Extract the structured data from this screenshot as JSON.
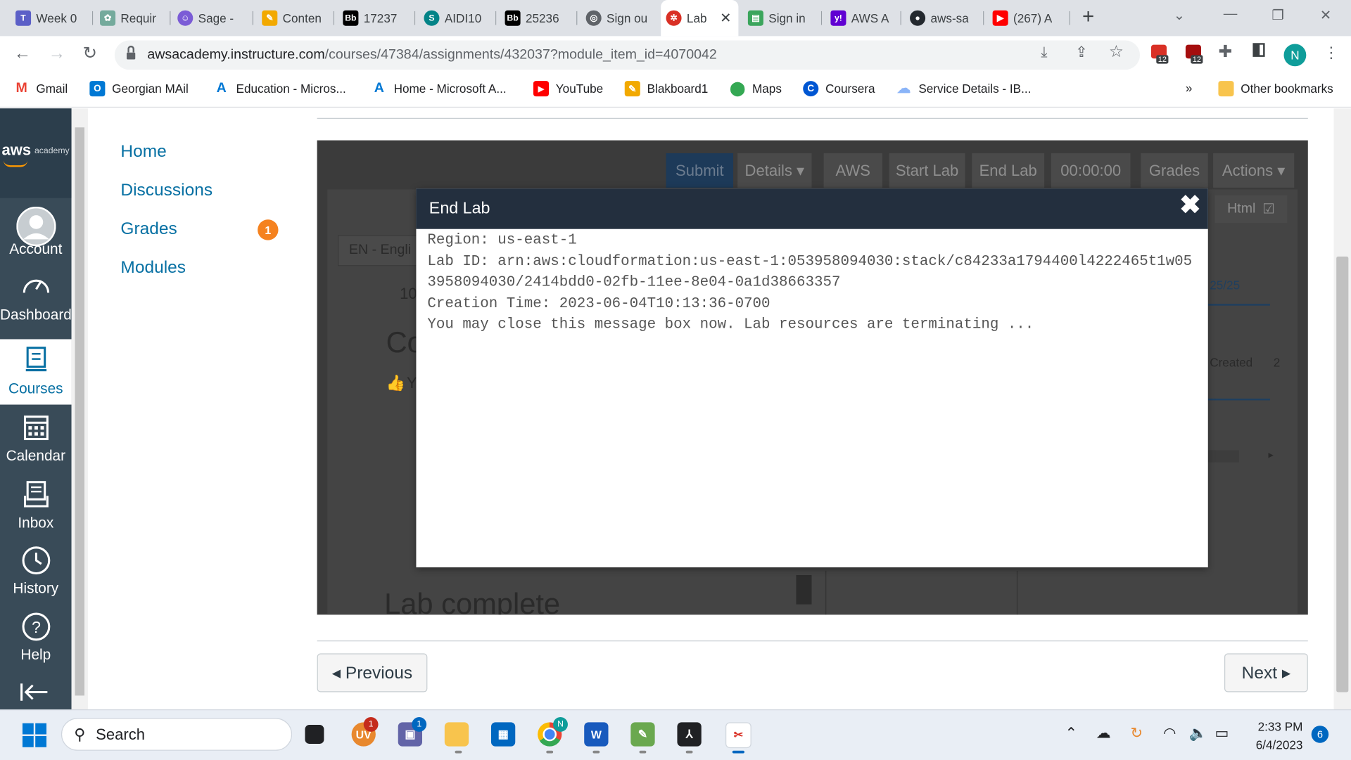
{
  "browser": {
    "tabs": [
      {
        "label": "Week 0",
        "icon": "teams-icon",
        "color": "#5b5fc7"
      },
      {
        "label": "Requir",
        "icon": "chatgpt-icon",
        "color": "#74aa9c"
      },
      {
        "label": "Sage -",
        "icon": "sage-icon",
        "color": "#7b5cd6"
      },
      {
        "label": "Conten",
        "icon": "blackboard-content-icon",
        "color": "#f2a900"
      },
      {
        "label": "17237",
        "icon": "bb-icon",
        "color": "#000000"
      },
      {
        "label": "AIDI10",
        "icon": "sharepoint-icon",
        "color": "#038387"
      },
      {
        "label": "25236",
        "icon": "bb-icon",
        "color": "#000000"
      },
      {
        "label": "Sign ou",
        "icon": "globe-icon",
        "color": "#5f6368"
      },
      {
        "label": "Lab",
        "icon": "lab-icon",
        "color": "#d93025",
        "active": true
      },
      {
        "label": "Sign in",
        "icon": "aws-signin-icon",
        "color": "#3ba55c"
      },
      {
        "label": "AWS A",
        "icon": "yahoo-icon",
        "color": "#6001d2"
      },
      {
        "label": "aws-sa",
        "icon": "github-icon",
        "color": "#24292f"
      },
      {
        "label": "(267) A",
        "icon": "youtube-icon",
        "color": "#ff0000"
      }
    ],
    "url_host": "awsacademy.instructure.com",
    "url_path": "/courses/47384/assignments/432037?module_item_id=4070042",
    "profile_initial": "N",
    "ext_badge_1": "12",
    "ext_badge_2": "12",
    "bookmarks": [
      {
        "label": "Gmail",
        "icon": "gmail-icon",
        "color": "#ea4335"
      },
      {
        "label": "Georgian MAil",
        "icon": "outlook-icon",
        "color": "#0078d4"
      },
      {
        "label": "Education - Micros...",
        "icon": "azure-icon",
        "color": "#0078d4"
      },
      {
        "label": "Home - Microsoft A...",
        "icon": "azure-icon",
        "color": "#0078d4"
      },
      {
        "label": "YouTube",
        "icon": "youtube-icon",
        "color": "#ff0000"
      },
      {
        "label": "Blakboard1",
        "icon": "blackboard-icon",
        "color": "#f2a900"
      },
      {
        "label": "Maps",
        "icon": "maps-icon",
        "color": "#34a853"
      },
      {
        "label": "Coursera",
        "icon": "coursera-icon",
        "color": "#0056d2"
      },
      {
        "label": "Service Details - IB...",
        "icon": "cloud-icon",
        "color": "#8ab4f8"
      }
    ],
    "more_bookmarks": "»",
    "other_bookmarks": "Other bookmarks"
  },
  "global_nav": {
    "brand_aws": "aws",
    "brand_academy": "academy",
    "items": [
      {
        "label": "Account",
        "icon": "account-icon"
      },
      {
        "label": "Dashboard",
        "icon": "dashboard-icon"
      },
      {
        "label": "Courses",
        "icon": "courses-icon",
        "active": true
      },
      {
        "label": "Calendar",
        "icon": "calendar-icon"
      },
      {
        "label": "Inbox",
        "icon": "inbox-icon"
      },
      {
        "label": "History",
        "icon": "history-icon"
      },
      {
        "label": "Help",
        "icon": "help-icon"
      }
    ]
  },
  "course_nav": {
    "items": [
      "Home",
      "Discussions",
      "Grades",
      "Modules"
    ],
    "grades_badge": "1"
  },
  "lab": {
    "buttons": [
      "Submit",
      "Details ▾",
      "AWS",
      "Start Lab",
      "End Lab",
      "00:00:00",
      "Grades",
      "Actions ▾"
    ],
    "html_toggle": "Html",
    "lang": "EN - Engli",
    "score": "25/25",
    "created": "Created",
    "created_count": "2",
    "partial_10": "10",
    "partial_co": "Co",
    "partial_y": "Y",
    "partial_lab_complete": "Lab complete"
  },
  "modal": {
    "title": "End Lab",
    "lines": [
      "Region: us-east-1",
      "Lab ID: arn:aws:cloudformation:us-east-1:053958094030:stack/c84233a1794400l4222465t1w053958094030/2414bdd0-02fb-11ee-8e04-0a1d38663357",
      "Creation Time: 2023-06-04T10:13:36-0700",
      "You may close this message box now. Lab resources are terminating ..."
    ]
  },
  "pager": {
    "previous": "◂ Previous",
    "next": "Next ▸"
  },
  "taskbar": {
    "search": "Search",
    "time": "2:33 PM",
    "date": "6/4/2023",
    "notifications": "6",
    "badge_uv": "1",
    "badge_teams": "1",
    "chrome_badge": "N"
  }
}
